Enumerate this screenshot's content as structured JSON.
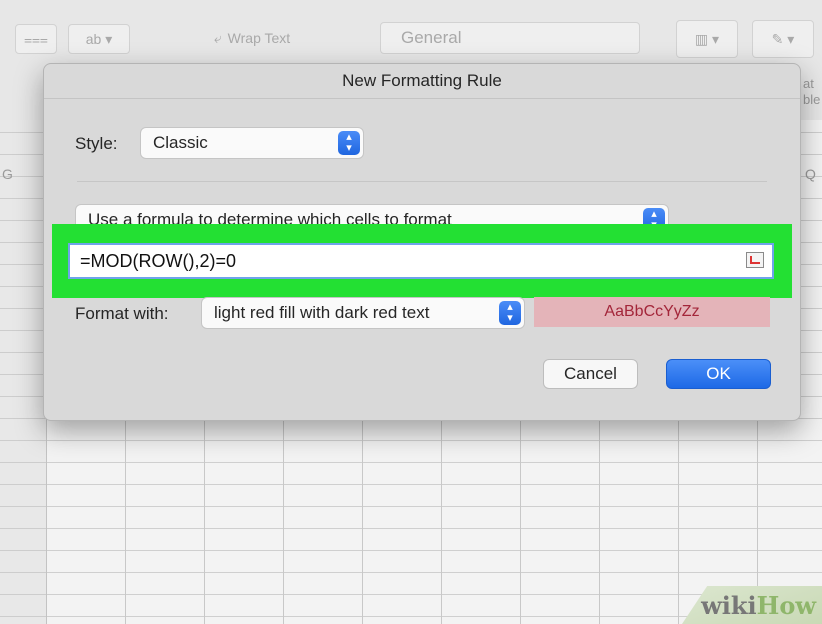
{
  "ribbon": {
    "wrap_text": "Wrap Text",
    "number_format": "General",
    "right_label_1": "at",
    "right_label_2": "ble"
  },
  "sheet": {
    "col_left": "G",
    "col_right": "Q"
  },
  "dialog": {
    "title": "New Formatting Rule",
    "style_label": "Style:",
    "style_value": "Classic",
    "rule_type": "Use a formula to determine which cells to format",
    "formula": "=MOD(ROW(),2)=0",
    "format_with_label": "Format with:",
    "format_with_value": "light red fill with dark red text",
    "preview_text": "AaBbCcYyZz",
    "cancel_label": "Cancel",
    "ok_label": "OK"
  },
  "watermark": {
    "part1": "wiki",
    "part2": "How"
  },
  "colors": {
    "highlight": "#23e033",
    "ok_button": "#1d69e6",
    "preview_fill": "#e4b4b9",
    "preview_text": "#a3263a"
  },
  "icons": [
    "stepper-icon",
    "collapse-dialog-icon"
  ]
}
